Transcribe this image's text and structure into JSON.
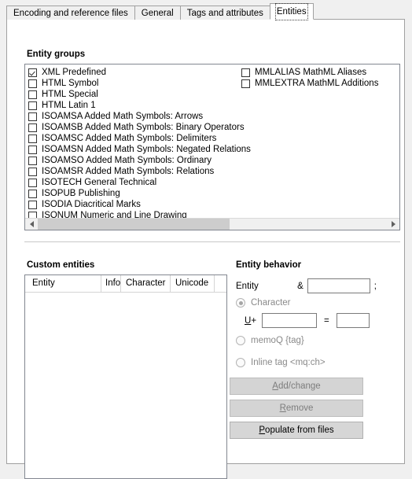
{
  "window": {
    "tabs": [
      {
        "label": "Encoding and reference files",
        "selected": false
      },
      {
        "label": "General",
        "selected": false
      },
      {
        "label": "Tags and attributes",
        "selected": false
      },
      {
        "label": "Entities",
        "selected": true
      }
    ]
  },
  "entity_groups": {
    "title": "Entity groups",
    "left_column": [
      {
        "label": "XML Predefined",
        "checked": true
      },
      {
        "label": "HTML Symbol",
        "checked": false
      },
      {
        "label": "HTML Special",
        "checked": false
      },
      {
        "label": "HTML Latin 1",
        "checked": false
      },
      {
        "label": "ISOAMSA Added Math Symbols: Arrows",
        "checked": false
      },
      {
        "label": "ISOAMSB Added Math Symbols: Binary Operators",
        "checked": false
      },
      {
        "label": "ISOAMSC Added Math Symbols: Delimiters",
        "checked": false
      },
      {
        "label": "ISOAMSN Added Math Symbols: Negated Relations",
        "checked": false
      },
      {
        "label": "ISOAMSO Added Math Symbols: Ordinary",
        "checked": false
      },
      {
        "label": "ISOAMSR Added Math Symbols: Relations",
        "checked": false
      },
      {
        "label": "ISOTECH General Technical",
        "checked": false
      },
      {
        "label": "ISOPUB Publishing",
        "checked": false
      },
      {
        "label": "ISODIA Diacritical Marks",
        "checked": false
      },
      {
        "label": "ISONUM Numeric and Line Drawing",
        "checked": false
      }
    ],
    "right_column": [
      {
        "label": "MMLALIAS MathML Aliases",
        "checked": false
      },
      {
        "label": "MMLEXTRA MathML Additions",
        "checked": false
      }
    ],
    "scrollbar": {
      "left_arrow": "◀",
      "right_arrow": "▶"
    }
  },
  "custom_entities": {
    "title": "Custom entities",
    "columns": [
      "Entity",
      "Info",
      "Character",
      "Unicode",
      ""
    ],
    "rows": []
  },
  "entity_behavior": {
    "title": "Entity behavior",
    "entity_label": "Entity",
    "ampersand": "&",
    "semicolon": ";",
    "entity_value": "",
    "entity_placeholder": "",
    "options": [
      {
        "label": "Character",
        "selected": true,
        "disabled": true
      },
      {
        "label": "memoQ {tag}",
        "selected": false,
        "disabled": true
      },
      {
        "label": "Inline tag <mq:ch>",
        "selected": false,
        "disabled": true
      }
    ],
    "uplus_label": "U+",
    "uplus_accel": "U",
    "uplus_rest": "+",
    "unicode_value": "",
    "equals": "=",
    "character_value": "",
    "buttons": [
      {
        "label": "Add/change",
        "accel": "A",
        "before": "",
        "after": "dd/change",
        "disabled": true
      },
      {
        "label": "Remove",
        "accel": "R",
        "before": "",
        "after": "emove",
        "disabled": true
      },
      {
        "label": "Populate from files",
        "accel": "P",
        "before": "",
        "after": "opulate from files",
        "disabled": false
      }
    ]
  }
}
